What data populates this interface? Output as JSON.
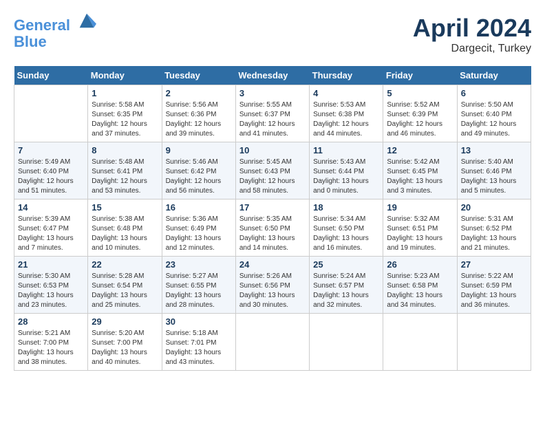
{
  "header": {
    "logo_line1": "General",
    "logo_line2": "Blue",
    "month": "April 2024",
    "location": "Dargecit, Turkey"
  },
  "weekdays": [
    "Sunday",
    "Monday",
    "Tuesday",
    "Wednesday",
    "Thursday",
    "Friday",
    "Saturday"
  ],
  "weeks": [
    [
      {
        "day": "",
        "info": ""
      },
      {
        "day": "1",
        "info": "Sunrise: 5:58 AM\nSunset: 6:35 PM\nDaylight: 12 hours\nand 37 minutes."
      },
      {
        "day": "2",
        "info": "Sunrise: 5:56 AM\nSunset: 6:36 PM\nDaylight: 12 hours\nand 39 minutes."
      },
      {
        "day": "3",
        "info": "Sunrise: 5:55 AM\nSunset: 6:37 PM\nDaylight: 12 hours\nand 41 minutes."
      },
      {
        "day": "4",
        "info": "Sunrise: 5:53 AM\nSunset: 6:38 PM\nDaylight: 12 hours\nand 44 minutes."
      },
      {
        "day": "5",
        "info": "Sunrise: 5:52 AM\nSunset: 6:39 PM\nDaylight: 12 hours\nand 46 minutes."
      },
      {
        "day": "6",
        "info": "Sunrise: 5:50 AM\nSunset: 6:40 PM\nDaylight: 12 hours\nand 49 minutes."
      }
    ],
    [
      {
        "day": "7",
        "info": "Sunrise: 5:49 AM\nSunset: 6:40 PM\nDaylight: 12 hours\nand 51 minutes."
      },
      {
        "day": "8",
        "info": "Sunrise: 5:48 AM\nSunset: 6:41 PM\nDaylight: 12 hours\nand 53 minutes."
      },
      {
        "day": "9",
        "info": "Sunrise: 5:46 AM\nSunset: 6:42 PM\nDaylight: 12 hours\nand 56 minutes."
      },
      {
        "day": "10",
        "info": "Sunrise: 5:45 AM\nSunset: 6:43 PM\nDaylight: 12 hours\nand 58 minutes."
      },
      {
        "day": "11",
        "info": "Sunrise: 5:43 AM\nSunset: 6:44 PM\nDaylight: 13 hours\nand 0 minutes."
      },
      {
        "day": "12",
        "info": "Sunrise: 5:42 AM\nSunset: 6:45 PM\nDaylight: 13 hours\nand 3 minutes."
      },
      {
        "day": "13",
        "info": "Sunrise: 5:40 AM\nSunset: 6:46 PM\nDaylight: 13 hours\nand 5 minutes."
      }
    ],
    [
      {
        "day": "14",
        "info": "Sunrise: 5:39 AM\nSunset: 6:47 PM\nDaylight: 13 hours\nand 7 minutes."
      },
      {
        "day": "15",
        "info": "Sunrise: 5:38 AM\nSunset: 6:48 PM\nDaylight: 13 hours\nand 10 minutes."
      },
      {
        "day": "16",
        "info": "Sunrise: 5:36 AM\nSunset: 6:49 PM\nDaylight: 13 hours\nand 12 minutes."
      },
      {
        "day": "17",
        "info": "Sunrise: 5:35 AM\nSunset: 6:50 PM\nDaylight: 13 hours\nand 14 minutes."
      },
      {
        "day": "18",
        "info": "Sunrise: 5:34 AM\nSunset: 6:50 PM\nDaylight: 13 hours\nand 16 minutes."
      },
      {
        "day": "19",
        "info": "Sunrise: 5:32 AM\nSunset: 6:51 PM\nDaylight: 13 hours\nand 19 minutes."
      },
      {
        "day": "20",
        "info": "Sunrise: 5:31 AM\nSunset: 6:52 PM\nDaylight: 13 hours\nand 21 minutes."
      }
    ],
    [
      {
        "day": "21",
        "info": "Sunrise: 5:30 AM\nSunset: 6:53 PM\nDaylight: 13 hours\nand 23 minutes."
      },
      {
        "day": "22",
        "info": "Sunrise: 5:28 AM\nSunset: 6:54 PM\nDaylight: 13 hours\nand 25 minutes."
      },
      {
        "day": "23",
        "info": "Sunrise: 5:27 AM\nSunset: 6:55 PM\nDaylight: 13 hours\nand 28 minutes."
      },
      {
        "day": "24",
        "info": "Sunrise: 5:26 AM\nSunset: 6:56 PM\nDaylight: 13 hours\nand 30 minutes."
      },
      {
        "day": "25",
        "info": "Sunrise: 5:24 AM\nSunset: 6:57 PM\nDaylight: 13 hours\nand 32 minutes."
      },
      {
        "day": "26",
        "info": "Sunrise: 5:23 AM\nSunset: 6:58 PM\nDaylight: 13 hours\nand 34 minutes."
      },
      {
        "day": "27",
        "info": "Sunrise: 5:22 AM\nSunset: 6:59 PM\nDaylight: 13 hours\nand 36 minutes."
      }
    ],
    [
      {
        "day": "28",
        "info": "Sunrise: 5:21 AM\nSunset: 7:00 PM\nDaylight: 13 hours\nand 38 minutes."
      },
      {
        "day": "29",
        "info": "Sunrise: 5:20 AM\nSunset: 7:00 PM\nDaylight: 13 hours\nand 40 minutes."
      },
      {
        "day": "30",
        "info": "Sunrise: 5:18 AM\nSunset: 7:01 PM\nDaylight: 13 hours\nand 43 minutes."
      },
      {
        "day": "",
        "info": ""
      },
      {
        "day": "",
        "info": ""
      },
      {
        "day": "",
        "info": ""
      },
      {
        "day": "",
        "info": ""
      }
    ]
  ]
}
